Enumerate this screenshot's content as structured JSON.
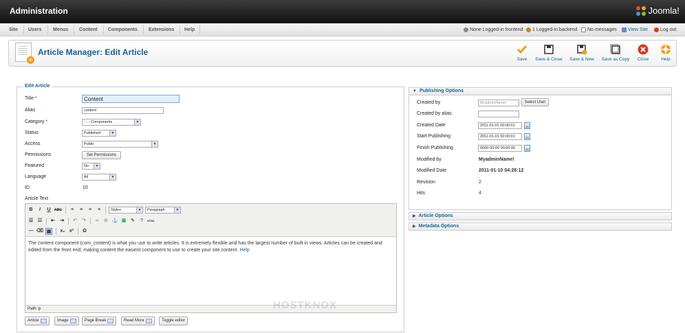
{
  "header": {
    "title": "Administration",
    "logo_text": "Joomla!"
  },
  "menu": {
    "items": [
      "Site",
      "Users",
      "Menus",
      "Content",
      "Components",
      "Extensions",
      "Help"
    ],
    "status": {
      "frontend": "None Logged-in frontend",
      "backend": "1 Logged-in backend",
      "messages": "No messages",
      "view_site": "View Site",
      "logout": "Log out"
    }
  },
  "toolbar": {
    "title": "Article Manager: Edit Article",
    "buttons": {
      "save": "Save",
      "save_close": "Save & Close",
      "save_new": "Save & New",
      "save_copy": "Save as Copy",
      "close": "Close",
      "help": "Help"
    }
  },
  "edit": {
    "legend": "Edit Article",
    "labels": {
      "title": "Title",
      "alias": "Alias",
      "category": "Category",
      "status": "Status",
      "access": "Access",
      "permissions": "Permissions",
      "featured": "Featured",
      "language": "Language",
      "id": "ID",
      "article_text": "Article Text"
    },
    "required_mark": "*",
    "values": {
      "title": "Content",
      "alias": "content",
      "category": "- - - Components",
      "status": "Published",
      "access": "Public",
      "permissions_button": "Set Permissions",
      "featured": "No",
      "language": "All",
      "id": "10"
    }
  },
  "editor": {
    "styles": "Styles",
    "format": "Paragraph",
    "content": "The content component (com_content) is what you use to write articles. It is extremely flexible and has the largest number of built in views. Articles can be created and edited from the front end, making content the easiest component to use to create your site content.",
    "link": "Help",
    "path": "Path: p",
    "buttons": {
      "article": "Article",
      "image": "Image",
      "page_break": "Page Break",
      "read_more": "Read More",
      "toggle": "Toggle editor"
    }
  },
  "publishing": {
    "heading": "Publishing Options",
    "labels": {
      "created_by": "Created by",
      "created_by_alias": "Created by alias",
      "created_date": "Created Date",
      "start_publishing": "Start Publishing",
      "finish_publishing": "Finish Publishing",
      "modified_by": "Modified by",
      "modified_date": "Modified Date",
      "revision": "Revision",
      "hits": "Hits"
    },
    "values": {
      "created_by_placeholder": "MyadminName!",
      "select_user": "Select User",
      "created_by_alias": "",
      "created_date": "2011-01-01 00:00:01",
      "start_publishing": "2011-01-01 00:00:01",
      "finish_publishing": "0000-00-00 00:00:00",
      "modified_by": "MyadminName!",
      "modified_date": "2011-01-10 04:28:12",
      "revision": "2",
      "hits": "4"
    }
  },
  "article_options": {
    "heading": "Article Options"
  },
  "metadata_options": {
    "heading": "Metadata Options"
  },
  "watermark": "HOSTKNOX",
  "colors": {
    "accent": "#146295",
    "header_bg": "#1a1a1a",
    "close_red": "#d9381e",
    "save_orange": "#f39c1d"
  }
}
